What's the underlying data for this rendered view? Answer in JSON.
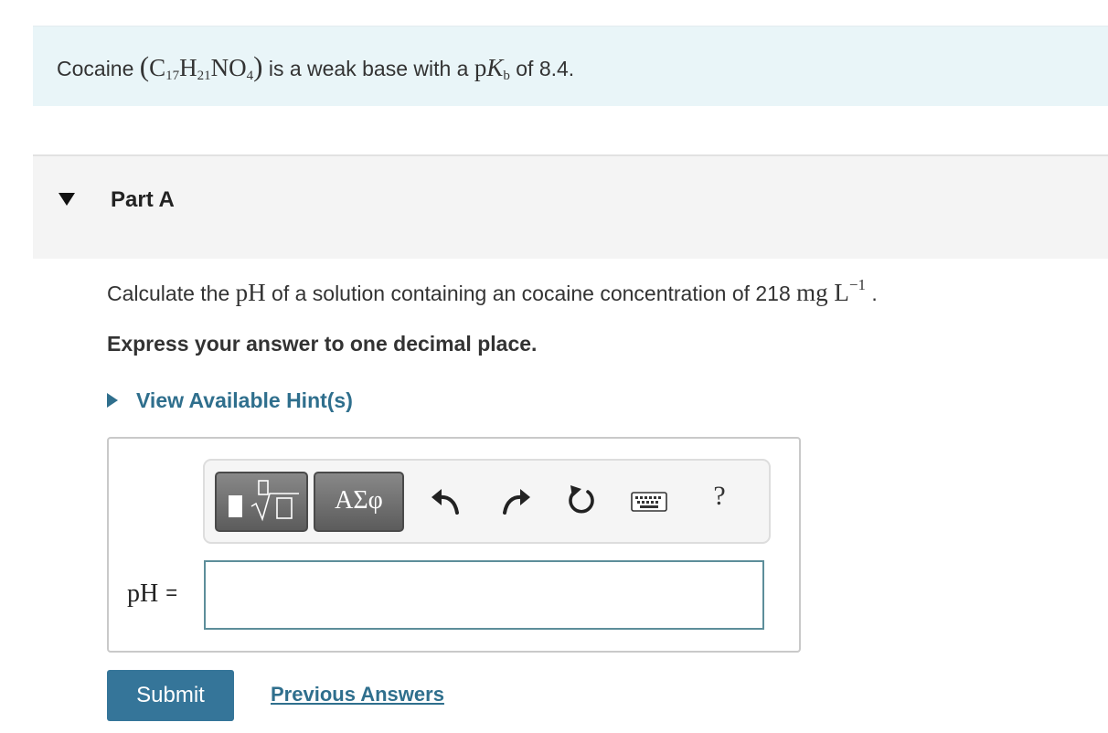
{
  "intro": {
    "prefix": "Cocaine ",
    "formula": {
      "open_paren": "(",
      "c": "C",
      "c_sub": "17",
      "h": "H",
      "h_sub": "21",
      "no": "NO",
      "o_sub": "4",
      "close_paren": ")"
    },
    "middle": " is a weak base with a ",
    "pkb": {
      "p": "p",
      "k": "K",
      "k_sub": "b"
    },
    "suffix": " of 8.4."
  },
  "part": {
    "title": "Part A",
    "expanded": true
  },
  "question": {
    "prefix": "Calculate the ",
    "ph": "pH",
    "middle": " of a solution containing an cocaine concentration of 218 ",
    "unit": "mg L",
    "unit_sup": "−1",
    "suffix": " ."
  },
  "instruction": "Express your answer to one decimal place.",
  "hints": {
    "label": "View Available Hint(s)"
  },
  "toolbar": {
    "templates_icon": "templates-sqrt-icon",
    "greek_label": "ΑΣφ",
    "undo_icon": "undo-arrow-icon",
    "redo_icon": "redo-arrow-icon",
    "reset_icon": "reset-circular-arrow-icon",
    "keyboard_icon": "keyboard-icon",
    "help_label": "?"
  },
  "answer": {
    "label": "pH",
    "equals": "=",
    "value": ""
  },
  "actions": {
    "submit_label": "Submit",
    "previous_label": "Previous Answers"
  },
  "colors": {
    "intro_bg": "#e9f5f8",
    "part_header_bg": "#f4f4f4",
    "link": "#2f6f8d",
    "submit_bg": "#357599",
    "input_border": "#5d8e9a"
  }
}
